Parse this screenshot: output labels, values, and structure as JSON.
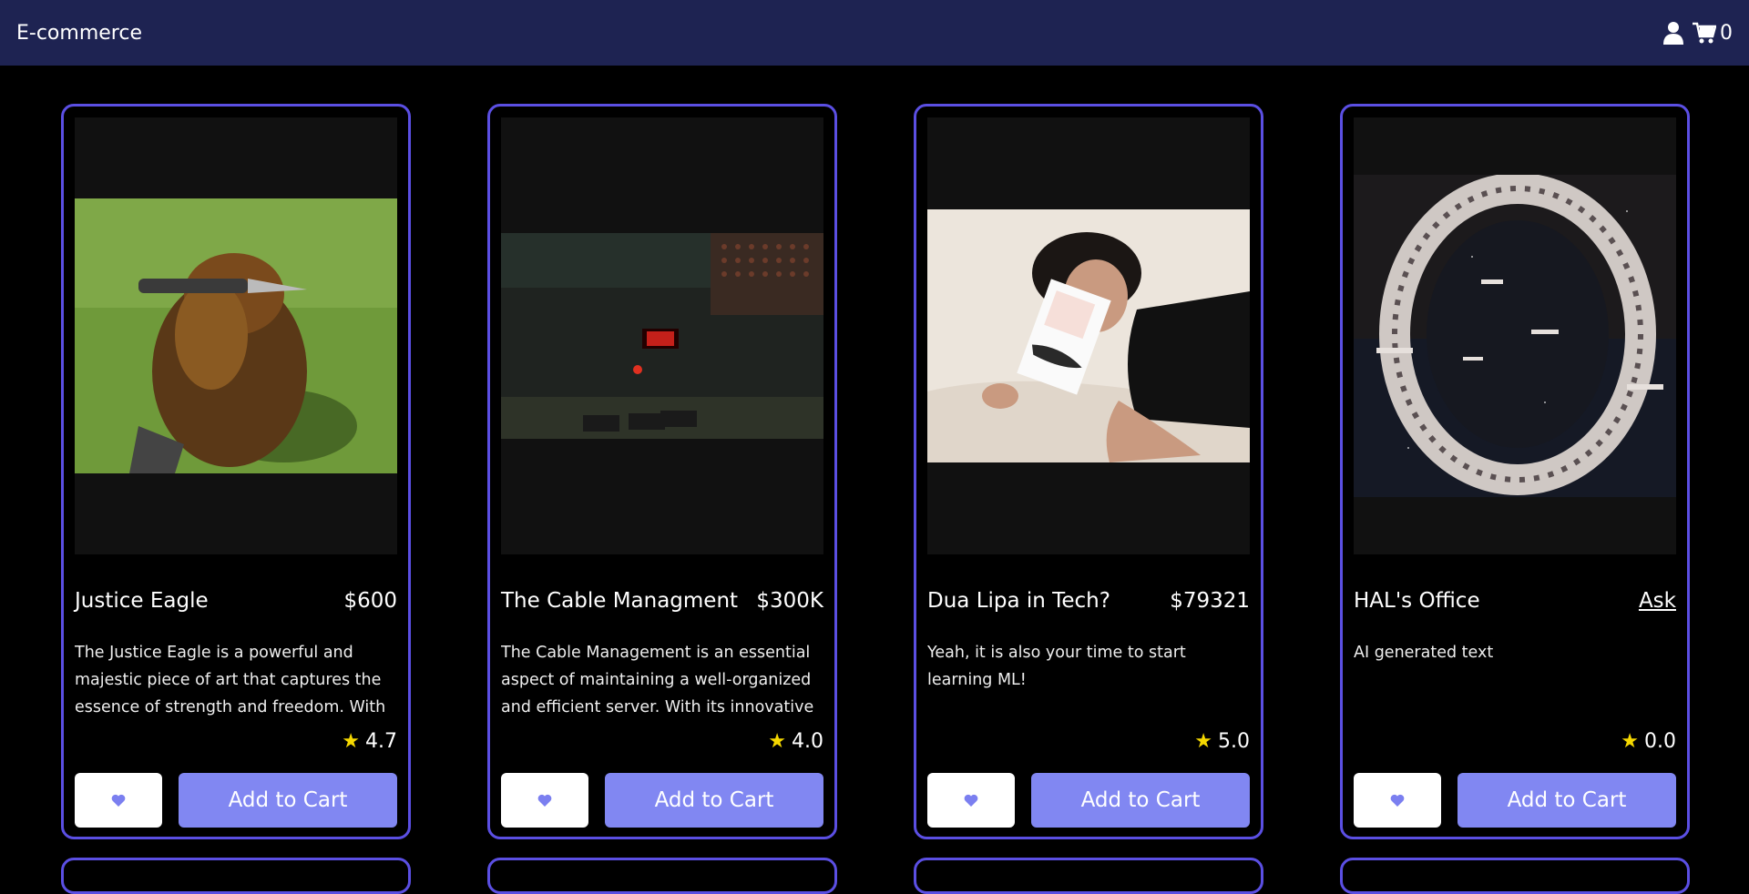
{
  "app": {
    "brand": "E-commerce",
    "cart_count": "0",
    "icons": {
      "user": "user-icon",
      "cart": "cart-icon"
    }
  },
  "colors": {
    "navbar": "#1e2352",
    "card_border": "#5b4fe3",
    "cart_button": "#8187f2",
    "star": "#f5d800"
  },
  "products": [
    {
      "title": "Justice Eagle",
      "price": "$600",
      "description": "The Justice Eagle is a powerful and majestic piece of art that captures the essence of strength and freedom. With its intricate...",
      "rating": "4.7",
      "favorite_icon": "heart-icon",
      "cart_label": "Add to Cart",
      "image_alt": "eagle-photo"
    },
    {
      "title": "The Cable Managment",
      "price": "$300K",
      "description": "The Cable Management is an essential aspect of maintaining a well-organized and efficient server. With its innovative design...",
      "rating": "4.0",
      "favorite_icon": "heart-icon",
      "cart_label": "Add to Cart",
      "image_alt": "medieval-device-photo"
    },
    {
      "title": "Dua Lipa in Tech?",
      "price": "$79321",
      "description": "Yeah, it is also your time to start learning ML!",
      "rating": "5.0",
      "favorite_icon": "heart-icon",
      "cart_label": "Add to Cart",
      "image_alt": "person-with-book-photo"
    },
    {
      "title": "HAL's Office",
      "price": "Ask",
      "description": "AI generated text",
      "rating": "0.0",
      "favorite_icon": "heart-icon",
      "cart_label": "Add to Cart",
      "image_alt": "space-station-image"
    }
  ]
}
